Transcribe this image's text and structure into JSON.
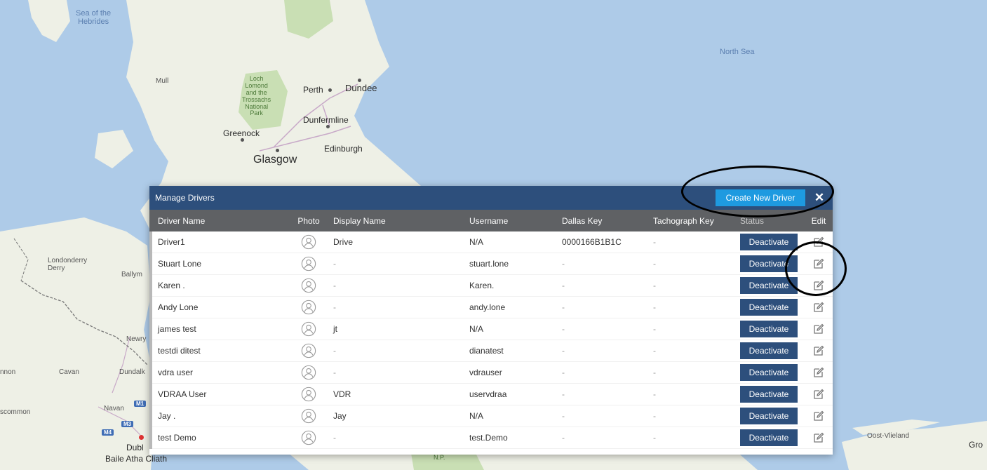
{
  "map": {
    "labels": {
      "sea_hebrides": "Sea of the\nHebrides",
      "north_sea": "North Sea",
      "mull": "Mull",
      "loch_lomond": "Loch\nLomond\nand the\nTrossachs\nNational\nPark",
      "perth": "Perth",
      "dundee": "Dundee",
      "dunfermline": "Dunfermline",
      "greenock": "Greenock",
      "edinburgh": "Edinburgh",
      "glasgow": "Glasgow",
      "londonderry": "Londonderry\nDerry",
      "ballymena": "Ballym",
      "newry": "Newry",
      "cavan": "Cavan",
      "dundalk": "Dundalk",
      "navan": "Navan",
      "scommon": "scommon",
      "nnon": "nnon",
      "dublin": "Dubl",
      "baile_atha_cliath": "Baile Atha Cliath",
      "oost_vlieland": "Oost-Vlieland",
      "gro": "Gro",
      "national_park_np": "N.P."
    },
    "shields": [
      "M1",
      "M3",
      "M4"
    ]
  },
  "dialog": {
    "title": "Manage Drivers",
    "create_label": "Create New Driver",
    "close_label": "✕",
    "columns": {
      "driver_name": "Driver Name",
      "photo": "Photo",
      "display_name": "Display Name",
      "username": "Username",
      "dallas_key": "Dallas Key",
      "tachograph_key": "Tachograph Key",
      "status": "Status",
      "edit": "Edit"
    },
    "rows": [
      {
        "driver_name": "Driver1",
        "display_name": "Drive",
        "username": "N/A",
        "dallas_key": "0000166B1B1C",
        "tachograph_key": "-",
        "action": "Deactivate"
      },
      {
        "driver_name": "Stuart Lone",
        "display_name": "-",
        "username": "stuart.lone",
        "dallas_key": "-",
        "tachograph_key": "-",
        "action": "Deactivate"
      },
      {
        "driver_name": "Karen .",
        "display_name": "-",
        "username": "Karen.",
        "dallas_key": "-",
        "tachograph_key": "-",
        "action": "Deactivate"
      },
      {
        "driver_name": "Andy Lone",
        "display_name": "-",
        "username": "andy.lone",
        "dallas_key": "-",
        "tachograph_key": "-",
        "action": "Deactivate"
      },
      {
        "driver_name": "james test",
        "display_name": "jt",
        "username": "N/A",
        "dallas_key": "-",
        "tachograph_key": "-",
        "action": "Deactivate"
      },
      {
        "driver_name": "testdi ditest",
        "display_name": "-",
        "username": "dianatest",
        "dallas_key": "-",
        "tachograph_key": "-",
        "action": "Deactivate"
      },
      {
        "driver_name": "vdra user",
        "display_name": "-",
        "username": "vdrauser",
        "dallas_key": "-",
        "tachograph_key": "-",
        "action": "Deactivate"
      },
      {
        "driver_name": "VDRAA User",
        "display_name": "VDR",
        "username": "uservdraa",
        "dallas_key": "-",
        "tachograph_key": "-",
        "action": "Deactivate"
      },
      {
        "driver_name": "Jay .",
        "display_name": "Jay",
        "username": "N/A",
        "dallas_key": "-",
        "tachograph_key": "-",
        "action": "Deactivate"
      },
      {
        "driver_name": "test Demo",
        "display_name": "-",
        "username": "test.Demo",
        "dallas_key": "-",
        "tachograph_key": "-",
        "action": "Deactivate"
      }
    ]
  },
  "icons": {
    "avatar": "user-avatar-icon",
    "edit": "pencil-edit-icon",
    "close": "close-icon"
  },
  "colors": {
    "header_bg": "#2d4f7c",
    "create_button": "#1e9ae0",
    "column_header_bg": "#5f6164",
    "deactivate_button": "#2d4f7c",
    "sea": "#aecbe8",
    "land": "#eef0e6",
    "park": "#c9dfb4"
  }
}
